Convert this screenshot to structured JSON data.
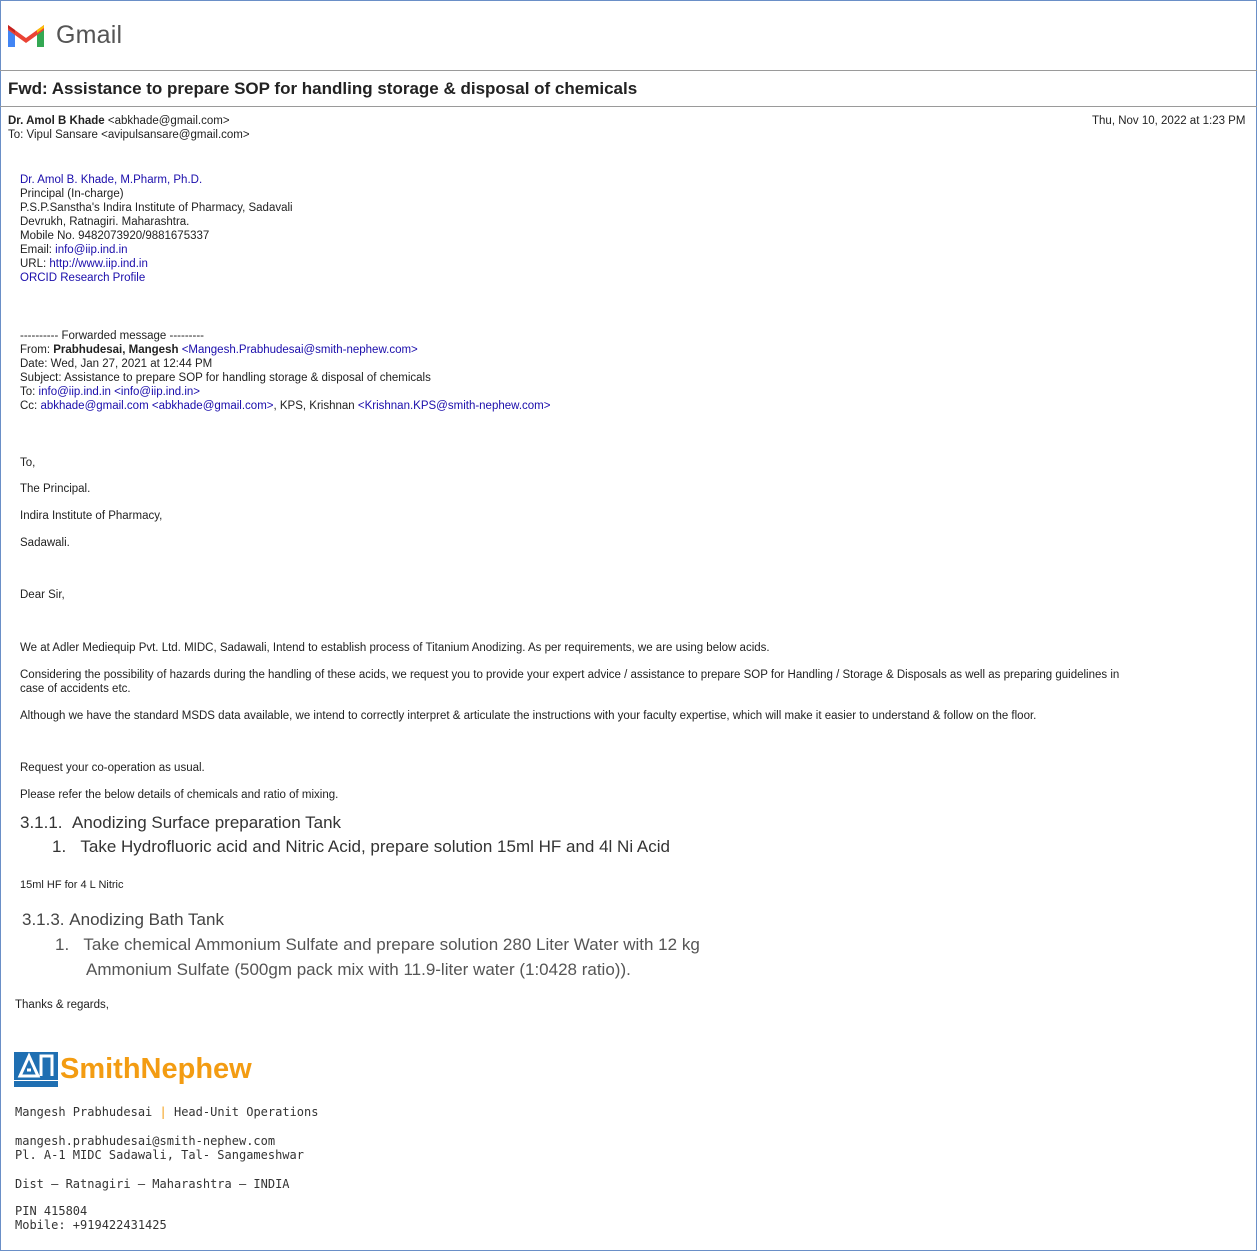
{
  "app": {
    "name": "Gmail"
  },
  "email": {
    "subject": "Fwd: Assistance to prepare SOP for handling storage & disposal of chemicals",
    "from_name": "Dr. Amol B Khade",
    "from_email": "<abkhade@gmail.com>",
    "to_line": "To: Vipul Sansare <avipulsansare@gmail.com>",
    "date": "Thu, Nov 10, 2022 at 1:23 PM"
  },
  "signature1": {
    "name": "Dr. Amol B. Khade, M.Pharm, Ph.D.",
    "title": "Principal (In-charge)",
    "institute": "P.S.P.Sanstha's Indira Institute of Pharmacy, Sadavali",
    "address": "Devrukh, Ratnagiri. Maharashtra.",
    "mobile": "Mobile No. 9482073920/9881675337",
    "email_label": "Email: ",
    "email": "info@iip.ind.in",
    "url_label": "URL: ",
    "url": "http://www.iip.ind.in",
    "orcid": "ORCID Research Profile"
  },
  "forwarded": {
    "marker": "---------- Forwarded message ---------",
    "from_label": "From: ",
    "from_name": "Prabhudesai, Mangesh",
    "from_email": "<Mangesh.Prabhudesai@smith-nephew.com>",
    "date": "Date: Wed, Jan 27, 2021 at 12:44 PM",
    "subject": "Subject: Assistance to prepare SOP for handling storage & disposal of chemicals",
    "to_label": "To: ",
    "to_email": "info@iip.ind.in",
    "to_email2": "<info@iip.ind.in>",
    "cc_label": "Cc: ",
    "cc_email": "abkhade@gmail.com",
    "cc_email2": "<abkhade@gmail.com>",
    "cc_mid": ", KPS, Krishnan ",
    "cc_email3": "<Krishnan.KPS@smith-nephew.com>"
  },
  "body": {
    "to": "To,",
    "line1": "The Principal.",
    "line2": "Indira Institute of Pharmacy,",
    "line3": "Sadawali.",
    "greeting": "Dear Sir,",
    "p1": "We at Adler Mediequip Pvt. Ltd. MIDC, Sadawali,  Intend to establish process of Titanium Anodizing. As per requirements, we are using below acids.",
    "p2a": "Considering the possibility of hazards during the handling of these acids, we request you to provide your expert advice / assistance to prepare SOP for Handling / Storage & Disposals as well as preparing guidelines in",
    "p2b": "case of accidents etc.",
    "p3": "Although we have the standard MSDS data available, we intend to correctly interpret & articulate the instructions with your faculty expertise, which will make it easier to understand & follow on the floor.",
    "p4": "Request your co-operation as usual.",
    "p5": "Please refer the below details of chemicals and ratio of mixing.",
    "sec1_num": "3.1.1.",
    "sec1_title": "Anodizing Surface preparation Tank",
    "sec1_item_num": "1.",
    "sec1_item": "Take Hydrofluoric acid and Nitric Acid, prepare solution 15ml HF and 4l Ni Acid",
    "note": "15ml HF for 4 L Nitric",
    "sec2_num": "3.1.3.",
    "sec2_title": "Anodizing Bath Tank",
    "sec2_item_num": "1.",
    "sec2_item_a": "Take  chemical  Ammonium  Sulfate  and  prepare  solution  280  Liter  Water  with  12  kg",
    "sec2_item_b": "Ammonium Sulfate (500gm pack mix with 11.9-liter water (1:0428 ratio)).",
    "thanks": "Thanks & regards,"
  },
  "signature2": {
    "logo_text": "SmithNephew",
    "name": "Mangesh Prabhudesai",
    "sep": "|",
    "role": "Head-Unit Operations",
    "email": "mangesh.prabhudesai@smith-nephew.com",
    "addr1": "Pl. A-1 MIDC Sadawali, Tal- Sangameshwar",
    "addr2": "Dist – Ratnagiri – Maharashtra – INDIA",
    "pin": "PIN 415804",
    "mobile": "Mobile: +919422431425"
  },
  "colors": {
    "link": "#1a0dab",
    "gmail_red": "#ea4335",
    "sn_orange": "#f39c12",
    "sn_blue": "#1f6fb2"
  }
}
